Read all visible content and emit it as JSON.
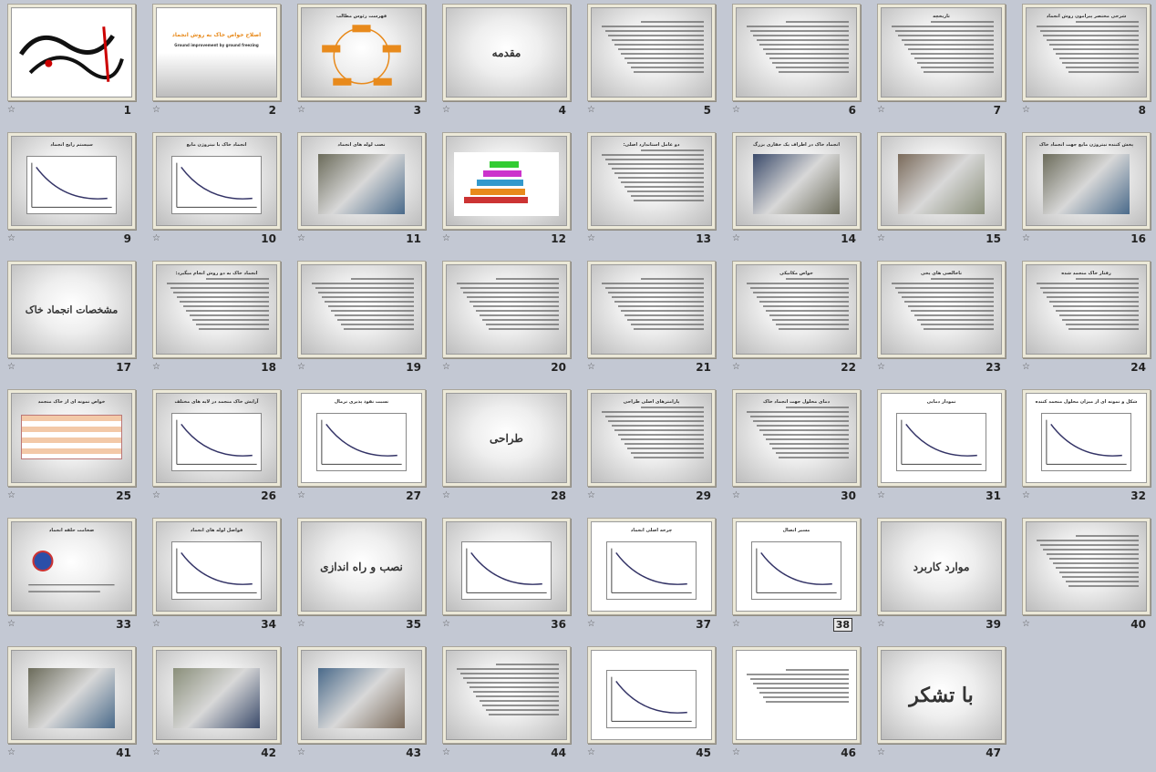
{
  "slides": [
    {
      "num": "1",
      "type": "logo",
      "title": ""
    },
    {
      "num": "2",
      "type": "title",
      "title": "اصلاح خواص خاک به روش انجماد",
      "subtitle": "Ground improvement by ground freezing"
    },
    {
      "num": "3",
      "type": "cycle",
      "title": "فهرست رئوس مطالب"
    },
    {
      "num": "4",
      "type": "heading",
      "title": "مقدمه"
    },
    {
      "num": "5",
      "type": "text",
      "title": ""
    },
    {
      "num": "6",
      "type": "text",
      "title": ""
    },
    {
      "num": "7",
      "type": "text",
      "title": "تاریخچه"
    },
    {
      "num": "8",
      "type": "text",
      "title": "شرحی مختصر پیرامون روش انجماد"
    },
    {
      "num": "9",
      "type": "diagram",
      "title": "سیستم رایج انجماد"
    },
    {
      "num": "10",
      "type": "diagram",
      "title": "انجماد خاک با نیتروژن مایع"
    },
    {
      "num": "11",
      "type": "photo",
      "title": "نصب لوله های انجماد"
    },
    {
      "num": "12",
      "type": "chart",
      "title": ""
    },
    {
      "num": "13",
      "type": "text",
      "title": "دو عامل استاندارد اصلی:"
    },
    {
      "num": "14",
      "type": "photo",
      "title": "انجماد خاک در اطراف یک حفاری بزرگ"
    },
    {
      "num": "15",
      "type": "photo",
      "title": ""
    },
    {
      "num": "16",
      "type": "photo",
      "title": "پخش کننده نیتروژن مایع جهت انجماد خاک"
    },
    {
      "num": "17",
      "type": "heading",
      "title": "مشخصات انجماد خاک"
    },
    {
      "num": "18",
      "type": "text",
      "title": "انجماد خاک به دو روش انجام میگیرد:"
    },
    {
      "num": "19",
      "type": "text",
      "title": ""
    },
    {
      "num": "20",
      "type": "text",
      "title": ""
    },
    {
      "num": "21",
      "type": "text",
      "title": ""
    },
    {
      "num": "22",
      "type": "text",
      "title": "خواص مکانیکی"
    },
    {
      "num": "23",
      "type": "text",
      "title": "ناخالصی های یخی"
    },
    {
      "num": "24",
      "type": "text",
      "title": "رفتار خاک منجمد شده"
    },
    {
      "num": "25",
      "type": "table",
      "title": "خواص نمونه ای از خاک منجمد"
    },
    {
      "num": "26",
      "type": "diagram",
      "title": "آرایش خاک منجمد در لایه های مختلف"
    },
    {
      "num": "27",
      "type": "graph",
      "title": "نسبت نفوذ پذیری نرمال"
    },
    {
      "num": "28",
      "type": "heading",
      "title": "طراحی"
    },
    {
      "num": "29",
      "type": "text",
      "title": "پارامترهای اصلی طراحی"
    },
    {
      "num": "30",
      "type": "text",
      "title": "دمای محلول جهت انجماد خاک"
    },
    {
      "num": "31",
      "type": "graph",
      "title": "نمودار دمایی"
    },
    {
      "num": "32",
      "type": "diagram",
      "title": "شکل و نمونه ای از میزان محلول منجمد کننده"
    },
    {
      "num": "33",
      "type": "formula",
      "title": "ضخامت حلقه انجماد"
    },
    {
      "num": "34",
      "type": "diagram",
      "title": "فواصل لوله های انجماد"
    },
    {
      "num": "35",
      "type": "heading",
      "title": "نصب و راه اندازی"
    },
    {
      "num": "36",
      "type": "diagram",
      "title": ""
    },
    {
      "num": "37",
      "type": "diagram",
      "title": "چرخه اصلی انجماد"
    },
    {
      "num": "38",
      "type": "diagram",
      "title": "مسیر اتصال"
    },
    {
      "num": "39",
      "type": "heading",
      "title": "موارد کاربرد"
    },
    {
      "num": "40",
      "type": "text",
      "title": ""
    },
    {
      "num": "41",
      "type": "photo",
      "title": ""
    },
    {
      "num": "42",
      "type": "photo",
      "title": ""
    },
    {
      "num": "43",
      "type": "photo",
      "title": ""
    },
    {
      "num": "44",
      "type": "text",
      "title": ""
    },
    {
      "num": "45",
      "type": "diagram",
      "title": ""
    },
    {
      "num": "46",
      "type": "refs",
      "title": ""
    },
    {
      "num": "47",
      "type": "heading",
      "title": "با تشکر"
    }
  ],
  "star_icon": "☆",
  "colors": {
    "background": "#c3c8d3",
    "frame": "#ece9d8",
    "accent": "#e88a1c"
  }
}
